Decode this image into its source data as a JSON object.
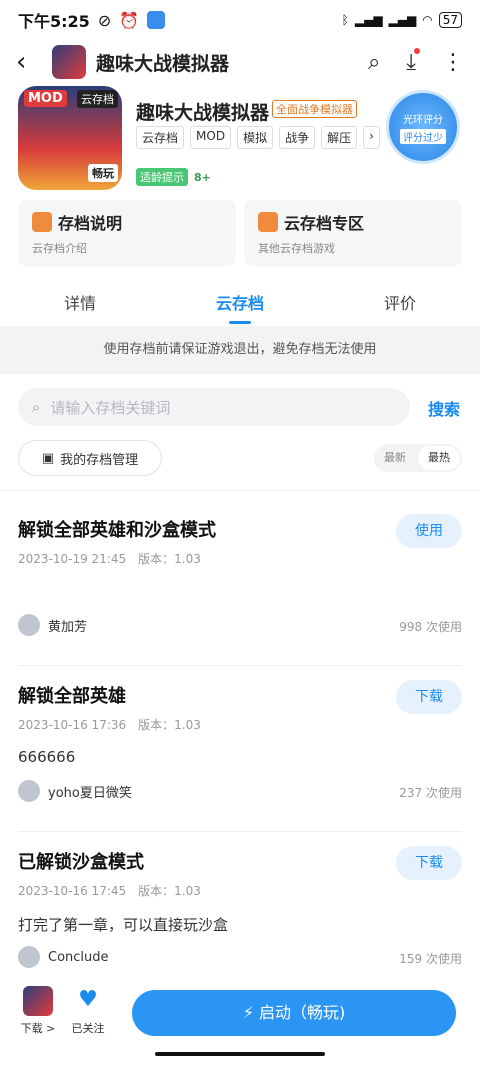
{
  "status": {
    "time": "下午5:25",
    "battery": "57"
  },
  "topbar": {
    "title": "趣味大战模拟器"
  },
  "app": {
    "name": "趣味大战模拟器",
    "badge": "全面战争模拟器",
    "icon_mod": "MOD",
    "icon_cloud": "云存档",
    "icon_play": "畅玩",
    "tags": [
      "云存档",
      "MOD",
      "模拟",
      "战争",
      "解压"
    ],
    "age_label": "适龄提示",
    "age": "8+",
    "score_line1": "光环评分",
    "score_line2": "评分过少"
  },
  "cards": [
    {
      "title": "存档说明",
      "sub": "云存档介绍"
    },
    {
      "title": "云存档专区",
      "sub": "其他云存档游戏"
    }
  ],
  "tabs": [
    "详情",
    "云存档",
    "评价"
  ],
  "notice": "使用存档前请保证游戏退出，避免存档无法使用",
  "search": {
    "placeholder": "请输入存档关键词",
    "button": "搜索"
  },
  "mine_button": "我的存档管理",
  "sort": [
    "最新",
    "最热"
  ],
  "saves": [
    {
      "title": "解锁全部英雄和沙盒模式",
      "date": "2023-10-19 21:45",
      "version": "版本：1.03",
      "desc": "",
      "user": "黄加芳",
      "count": "998 次使用",
      "action": "使用"
    },
    {
      "title": "解锁全部英雄",
      "date": "2023-10-16 17:36",
      "version": "版本：1.03",
      "desc": "666666",
      "user": "yoho夏日微笑",
      "count": "237 次使用",
      "action": "下载"
    },
    {
      "title": "已解锁沙盒模式",
      "date": "2023-10-16 17:45",
      "version": "版本：1.03",
      "desc": "打完了第一章，可以直接玩沙盒",
      "user": "Conclude",
      "count": "159 次使用",
      "action": "下载"
    }
  ],
  "bottom": {
    "download": "下载 >",
    "followed": "已关注",
    "launch": "启动（畅玩)"
  }
}
